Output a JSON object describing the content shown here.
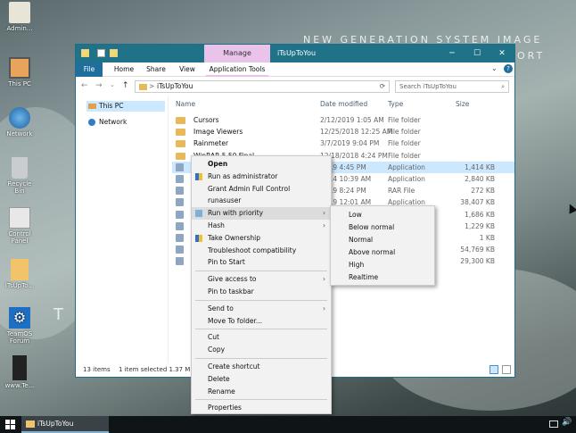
{
  "wallpaper": {
    "line1": "NEW GENERATION SYSTEM IMAGE",
    "line2_frag": "ORT",
    "left_frag": "T O"
  },
  "desktop_icons": [
    {
      "label": "Admin...",
      "icon": "user-icon"
    },
    {
      "label": "This PC",
      "icon": "computer-icon"
    },
    {
      "label": "Network",
      "icon": "network-icon"
    },
    {
      "label": "Recycle Bin",
      "icon": "recycle-bin-icon"
    },
    {
      "label": "Control Panel",
      "icon": "control-panel-icon"
    },
    {
      "label": "iTsUpTo...",
      "icon": "folder-icon"
    },
    {
      "label": "TeamOS Forum",
      "icon": "gear-icon"
    },
    {
      "label": "www.Te...",
      "icon": "book-icon"
    }
  ],
  "explorer": {
    "manage_tab": "Manage",
    "title": "iTsUpToYou",
    "tabs": [
      "File",
      "Home",
      "Share",
      "View",
      "Application Tools"
    ],
    "address": "iTsUpToYou",
    "address_prefix": ">",
    "search_placeholder": "Search iTsUpToYou",
    "nav": [
      {
        "label": "This PC",
        "icon": "computer-icon"
      },
      {
        "label": "Network",
        "icon": "network-icon"
      }
    ],
    "columns": {
      "name": "Name",
      "date": "Date modified",
      "type": "Type",
      "size": "Size"
    },
    "rows": [
      {
        "name": "Cursors",
        "date": "2/12/2019 1:05 AM",
        "type": "File folder",
        "size": ""
      },
      {
        "name": "Image Viewers",
        "date": "12/25/2018 12:25 AM",
        "type": "File folder",
        "size": ""
      },
      {
        "name": "Rainmeter",
        "date": "3/7/2019 9:04 PM",
        "type": "File folder",
        "size": ""
      },
      {
        "name": "WinRAR 5.50 Final",
        "date": "12/18/2018 4:24 PM",
        "type": "File folder",
        "size": ""
      },
      {
        "name": "T",
        "date": "2019 4:45 PM",
        "type": "Application",
        "size": "1,414 KB"
      },
      {
        "name": "F",
        "date": "2014 10:39 AM",
        "type": "Application",
        "size": "2,840 KB"
      },
      {
        "name": "C",
        "date": "2019 8:24 PM",
        "type": "RAR File",
        "size": "272 KB"
      },
      {
        "name": "o",
        "date": "2019 12:01 AM",
        "type": "Application",
        "size": "38,407 KB"
      },
      {
        "name": "I",
        "date": "",
        "type": "",
        "size": "1,686 KB"
      },
      {
        "name": "S",
        "date": "",
        "type": "",
        "size": "1,229 KB"
      },
      {
        "name": "T",
        "date": "",
        "type": "t",
        "size": "1 KB"
      },
      {
        "name": "t",
        "date": "",
        "type": "",
        "size": "54,769 KB"
      },
      {
        "name": "V",
        "date": "",
        "type": "",
        "size": "29,300 KB"
      }
    ],
    "status": {
      "count": "13 items",
      "selected": "1 item selected  1.37 MB"
    }
  },
  "context_menu": [
    {
      "label": "Open",
      "bold": true
    },
    {
      "label": "Run as administrator",
      "icon": "shield-icon"
    },
    {
      "label": "Grant Admin Full Control"
    },
    {
      "label": "runasuser"
    },
    {
      "label": "Run with priority",
      "icon": "priority-icon",
      "submenu": true,
      "highlight": true
    },
    {
      "label": "Hash",
      "submenu": true
    },
    {
      "label": "Take Ownership",
      "icon": "shield-icon"
    },
    {
      "label": "Troubleshoot compatibility"
    },
    {
      "label": "Pin to Start"
    },
    {
      "sep": true
    },
    {
      "label": "Give access to",
      "submenu": true
    },
    {
      "label": "Pin to taskbar"
    },
    {
      "sep": true
    },
    {
      "label": "Send to",
      "submenu": true
    },
    {
      "label": "Move To folder..."
    },
    {
      "sep": true
    },
    {
      "label": "Cut"
    },
    {
      "label": "Copy"
    },
    {
      "sep": true
    },
    {
      "label": "Create shortcut"
    },
    {
      "label": "Delete"
    },
    {
      "label": "Rename"
    },
    {
      "sep": true
    },
    {
      "label": "Properties"
    }
  ],
  "priority_menu": [
    "Low",
    "Below normal",
    "Normal",
    "Above normal",
    "High",
    "Realtime"
  ],
  "taskbar": {
    "active_window": "iTsUpToYou"
  },
  "colors": {
    "titlebar": "#1f7288",
    "manage_tab": "#e9c3e9",
    "selection": "#cce8ff",
    "taskbar": "#0f1417"
  }
}
